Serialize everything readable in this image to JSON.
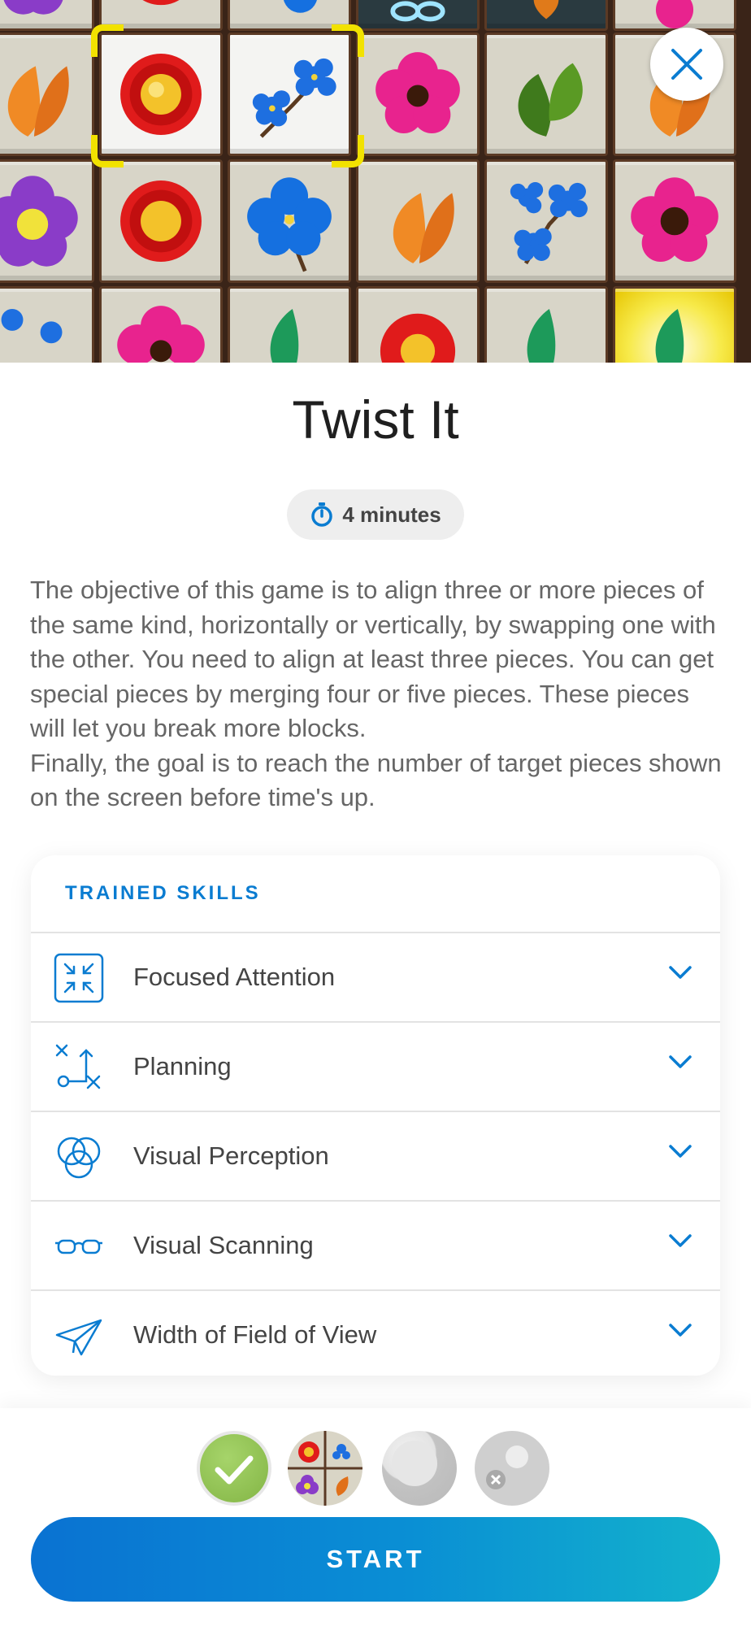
{
  "game": {
    "title": "Twist It",
    "duration_label": "4 minutes",
    "description": [
      "The objective of this game is to align three or more pieces of the same kind, horizontally or vertically, by swapping one with the other. You need to align at least three pieces. You can get special pieces by merging four or five pieces. These pieces will let you break more blocks.",
      "Finally, the goal is to reach the number of target pieces shown on the screen before time's up."
    ]
  },
  "skills": {
    "header": "TRAINED SKILLS",
    "items": [
      {
        "label": "Focused Attention",
        "icon": "focus-arrows-icon"
      },
      {
        "label": "Planning",
        "icon": "strategy-plan-icon"
      },
      {
        "label": "Visual Perception",
        "icon": "overlapping-circles-icon"
      },
      {
        "label": "Visual Scanning",
        "icon": "glasses-icon"
      },
      {
        "label": "Width of Field of View",
        "icon": "paper-plane-icon"
      }
    ]
  },
  "modes": [
    {
      "name": "completed",
      "icon": "checkmark-icon"
    },
    {
      "name": "tutorial",
      "icon": "flower-grid-icon"
    },
    {
      "name": "level",
      "icon": "gray-ball-icon"
    },
    {
      "name": "locked",
      "icon": "locked-ball-icon"
    }
  ],
  "actions": {
    "start_label": "START",
    "close_icon": "close-icon"
  },
  "colors": {
    "accent": "#0a7cd1",
    "start_gradient_start": "#0a72d2",
    "start_gradient_end": "#13b2cc",
    "selection": "#f2e200",
    "completed_green": "#8bbf4e"
  }
}
